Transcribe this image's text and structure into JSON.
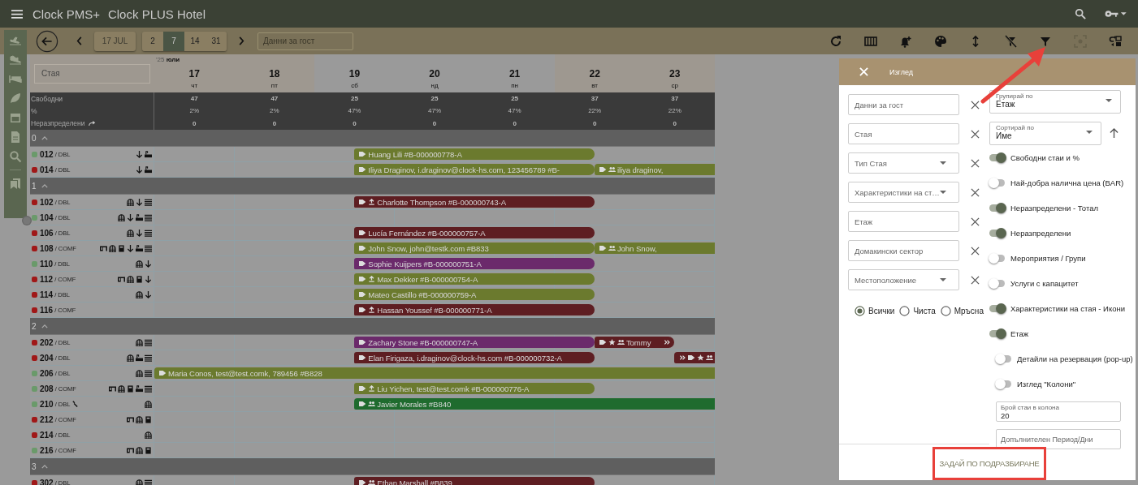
{
  "app": {
    "product": "Clock PMS+",
    "hotel": "Clock PLUS Hotel"
  },
  "toolbar": {
    "date_button": "17 JUL",
    "ranges": [
      {
        "label": "2",
        "selected": false
      },
      {
        "label": "7",
        "selected": true
      },
      {
        "label": "14",
        "selected": false
      },
      {
        "label": "31",
        "selected": false
      }
    ],
    "guest_search": {
      "placeholder": "Данни за гост"
    },
    "tools": [
      {
        "kind": "refresh",
        "disabled": false
      },
      {
        "kind": "columns",
        "disabled": false
      },
      {
        "kind": "bell-plus",
        "disabled": false
      },
      {
        "kind": "palette",
        "disabled": false
      },
      {
        "kind": "updown",
        "disabled": false
      },
      {
        "kind": "filter-off",
        "disabled": false
      },
      {
        "kind": "filter",
        "disabled": false
      },
      {
        "kind": "focus",
        "disabled": true
      },
      {
        "kind": "swap",
        "disabled": false
      }
    ]
  },
  "calendar": {
    "room_search": {
      "placeholder": "Стая"
    },
    "month_label": "'25 **юли**",
    "stat_labels": [
      "Свободни",
      "%",
      "Неразпределени"
    ],
    "days": [
      {
        "date": "17",
        "weekday": "чт",
        "free": "47",
        "percent": "2%",
        "unassigned": "0"
      },
      {
        "date": "18",
        "weekday": "пт",
        "free": "47",
        "percent": "2%",
        "unassigned": "0"
      },
      {
        "date": "19",
        "weekday": "сб",
        "free": "25",
        "percent": "47%",
        "unassigned": "0"
      },
      {
        "date": "20",
        "weekday": "нд",
        "free": "25",
        "percent": "47%",
        "unassigned": "0"
      },
      {
        "date": "21",
        "weekday": "пн",
        "free": "25",
        "percent": "47%",
        "unassigned": "0"
      },
      {
        "date": "22",
        "weekday": "вт",
        "free": "37",
        "percent": "22%",
        "unassigned": "0"
      },
      {
        "date": "23",
        "weekday": "ср",
        "free": "37",
        "percent": "22%",
        "unassigned": "0"
      }
    ],
    "groups": [
      {
        "floor": "0",
        "expanded": true,
        "rooms": [
          {
            "number": "012",
            "type": "/ DBL",
            "color": "#6a9a6a",
            "maintenance": false,
            "features": [
              {
                "kind": "down"
              },
              {
                "kind": "bath"
              }
            ],
            "bookings": [
              {
                "guest": "Huang Lili #B-000000778-A",
                "color": "#6b7a2e",
                "kind": "stay",
                "icons": [
                  {
                    "kind": "tag"
                  }
                ]
              }
            ]
          },
          {
            "number": "014",
            "type": "/ DBL",
            "color": "#a01818",
            "maintenance": false,
            "features": [
              {
                "kind": "down"
              },
              {
                "kind": "bath"
              }
            ],
            "bookings": [
              {
                "guest": "Iliya Draginov, i.draginov@clock-hs.com, 123456789 #B-",
                "color": "#6b7a2e",
                "kind": "stay",
                "icons": [
                  {
                    "kind": "tag"
                  }
                ]
              },
              {
                "guest": "iliya draginov,",
                "color": "#6b7a2e",
                "kind": "late",
                "icons": [
                  {
                    "kind": "tag"
                  },
                  {
                    "kind": "group"
                  }
                ]
              }
            ]
          }
        ]
      },
      {
        "floor": "1",
        "expanded": true,
        "rooms": [
          {
            "number": "102",
            "type": "/ DBL",
            "color": "#a01818",
            "maintenance": false,
            "features": [
              {
                "kind": "dome"
              },
              {
                "kind": "down"
              },
              {
                "kind": "heater"
              }
            ],
            "bookings": [
              {
                "guest": "Charlotte Thompson #B-000000743-A",
                "color": "#5e1e22",
                "kind": "stay",
                "icons": [
                  {
                    "kind": "tag"
                  },
                  {
                    "kind": "checkin"
                  }
                ]
              }
            ]
          },
          {
            "number": "104",
            "type": "/ DBL",
            "color": "#6a9a6a",
            "maintenance": false,
            "features": [
              {
                "kind": "dome"
              },
              {
                "kind": "down"
              },
              {
                "kind": "bath"
              },
              {
                "kind": "heater"
              }
            ]
          },
          {
            "number": "106",
            "type": "/ DBL",
            "color": "#a01818",
            "maintenance": false,
            "features": [
              {
                "kind": "dome"
              },
              {
                "kind": "down"
              },
              {
                "kind": "heater"
              }
            ],
            "bookings": [
              {
                "guest": "Lucía Fernández #B-000000757-A",
                "color": "#5e1e22",
                "kind": "stay",
                "icons": [
                  {
                    "kind": "tag"
                  }
                ]
              }
            ]
          },
          {
            "number": "108",
            "type": "/ COMF",
            "color": "#a01818",
            "maintenance": false,
            "features": [
              {
                "kind": "cabinet"
              },
              {
                "kind": "dome"
              },
              {
                "kind": "fridge"
              },
              {
                "kind": "down"
              },
              {
                "kind": "bath"
              },
              {
                "kind": "heater"
              }
            ],
            "bookings": [
              {
                "guest": "John Snow, john@testk.com #B833",
                "color": "#6b7a2e",
                "kind": "stay",
                "icons": [
                  {
                    "kind": "tag"
                  }
                ]
              },
              {
                "guest": "John Snow,",
                "color": "#6b7a2e",
                "kind": "late",
                "icons": [
                  {
                    "kind": "tag"
                  },
                  {
                    "kind": "group"
                  }
                ]
              }
            ]
          },
          {
            "number": "110",
            "type": "/ DBL",
            "color": "#6a9a6a",
            "maintenance": false,
            "features": [
              {
                "kind": "dome"
              },
              {
                "kind": "down"
              }
            ],
            "bookings": [
              {
                "guest": "Sophie Kuijpers #B-000000751-A",
                "color": "#6b2a6b",
                "kind": "stay",
                "icons": [
                  {
                    "kind": "tag"
                  }
                ]
              }
            ]
          },
          {
            "number": "112",
            "type": "/ COMF",
            "color": "#a01818",
            "maintenance": false,
            "features": [
              {
                "kind": "cabinet"
              },
              {
                "kind": "dome"
              },
              {
                "kind": "fridge"
              },
              {
                "kind": "down"
              }
            ],
            "bookings": [
              {
                "guest": "Max Dekker #B-000000754-A",
                "color": "#6b7a2e",
                "kind": "stay",
                "icons": [
                  {
                    "kind": "tag"
                  },
                  {
                    "kind": "checkin"
                  }
                ]
              }
            ]
          },
          {
            "number": "114",
            "type": "/ DBL",
            "color": "#a01818",
            "maintenance": false,
            "features": [
              {
                "kind": "dome"
              },
              {
                "kind": "down"
              }
            ],
            "bookings": [
              {
                "guest": "Mateo Castillo #B-000000759-A",
                "color": "#6b7a2e",
                "kind": "stay",
                "icons": [
                  {
                    "kind": "tag"
                  }
                ]
              }
            ]
          },
          {
            "number": "116",
            "type": "/ COMF",
            "color": "#a01818",
            "maintenance": false,
            "bookings": [
              {
                "guest": "Hassan Youssef #B-000000771-A",
                "color": "#5e1e22",
                "kind": "stay",
                "icons": [
                  {
                    "kind": "tag"
                  },
                  {
                    "kind": "checkin"
                  }
                ]
              }
            ]
          }
        ]
      },
      {
        "floor": "2",
        "expanded": true,
        "rooms": [
          {
            "number": "202",
            "type": "/ DBL",
            "color": "#a01818",
            "maintenance": false,
            "features": [
              {
                "kind": "dome"
              },
              {
                "kind": "heater"
              }
            ],
            "bookings": [
              {
                "guest": "Zachary Stone #B-000000747-A",
                "color": "#6b2a6b",
                "kind": "stay",
                "icons": [
                  {
                    "kind": "tag"
                  }
                ]
              },
              {
                "guest": "Tommy",
                "color": "#5e1e22",
                "kind": "short",
                "icons": [
                  {
                    "kind": "tag"
                  },
                  {
                    "kind": "star"
                  },
                  {
                    "kind": "group"
                  }
                ],
                "trailing_icons": [
                  {
                    "kind": "chevrons"
                  }
                ]
              }
            ]
          },
          {
            "number": "204",
            "type": "/ DBL",
            "color": "#a01818",
            "maintenance": false,
            "features": [
              {
                "kind": "dome"
              },
              {
                "kind": "bath"
              },
              {
                "kind": "heater"
              }
            ],
            "bookings": [
              {
                "guest": "Elan Firigaza, i.draginov@clock-hs.com #B-000000732-A",
                "color": "#5e1e22",
                "kind": "stay",
                "icons": [
                  {
                    "kind": "tag"
                  }
                ]
              },
              {
                "color": "#5e1e22",
                "kind": "edge",
                "icons": [
                  {
                    "kind": "chevrons"
                  },
                  {
                    "kind": "tag"
                  },
                  {
                    "kind": "star"
                  },
                  {
                    "kind": "group"
                  }
                ]
              }
            ]
          },
          {
            "number": "206",
            "type": "/ DBL",
            "color": "#6a9a6a",
            "maintenance": false,
            "features": [
              {
                "kind": "dome"
              },
              {
                "kind": "heater"
              }
            ],
            "bookings": [
              {
                "guest": "Maria Conos, test@test.comk, 789456 #B828",
                "color": "#6b7a2e",
                "kind": "full",
                "icons": [
                  {
                    "kind": "tag"
                  }
                ]
              }
            ]
          },
          {
            "number": "208",
            "type": "/ COMF",
            "color": "#6a9a6a",
            "maintenance": false,
            "features": [
              {
                "kind": "cabinet"
              },
              {
                "kind": "dome"
              },
              {
                "kind": "fridge"
              },
              {
                "kind": "bath"
              },
              {
                "kind": "heater"
              }
            ],
            "bookings": [
              {
                "guest": "Liu Yichen, test@test.comk #B-000000776-A",
                "color": "#6b7a2e",
                "kind": "stay",
                "icons": [
                  {
                    "kind": "tag"
                  },
                  {
                    "kind": "checkin"
                  }
                ]
              }
            ]
          },
          {
            "number": "210",
            "type": "/ DBL",
            "color": "#6a9a6a",
            "maintenance": true,
            "features": [
              {
                "kind": "dome"
              }
            ],
            "bookings": [
              {
                "guest": "Javier Morales #B840",
                "color": "#1f6b2e",
                "kind": "open",
                "icons": [
                  {
                    "kind": "tag"
                  },
                  {
                    "kind": "group"
                  }
                ]
              }
            ]
          },
          {
            "number": "212",
            "type": "/ COMF",
            "color": "#a01818",
            "maintenance": false,
            "features": [
              {
                "kind": "cabinet"
              },
              {
                "kind": "dome"
              },
              {
                "kind": "fridge"
              }
            ]
          },
          {
            "number": "214",
            "type": "/ DBL",
            "color": "#a01818",
            "maintenance": false,
            "features": [
              {
                "kind": "dome"
              }
            ]
          },
          {
            "number": "216",
            "type": "/ COMF",
            "color": "#6a9a6a",
            "maintenance": false,
            "features": [
              {
                "kind": "cabinet"
              },
              {
                "kind": "dome"
              },
              {
                "kind": "fridge"
              }
            ]
          }
        ]
      },
      {
        "floor": "3",
        "expanded": true,
        "rooms": [
          {
            "number": "302",
            "type": "/ DBL",
            "color": "#a01818",
            "maintenance": false,
            "features": [
              {
                "kind": "dome"
              },
              {
                "kind": "heater"
              }
            ],
            "bookings": [
              {
                "guest": "Ethan Marshall #B839",
                "color": "#5e1e22",
                "kind": "stay",
                "icons": [
                  {
                    "kind": "tag"
                  },
                  {
                    "kind": "group"
                  }
                ]
              }
            ]
          }
        ]
      }
    ]
  },
  "view_panel": {
    "title": "Изглед",
    "filters": [
      {
        "placeholder": "Данни за гост",
        "kind": "text"
      },
      {
        "placeholder": "Стая",
        "kind": "text"
      },
      {
        "placeholder": "Тип Стая",
        "kind": "select"
      },
      {
        "placeholder": "Характеристики на ст…",
        "kind": "select"
      },
      {
        "placeholder": "Етаж",
        "kind": "text"
      },
      {
        "placeholder": "Домакински сектор",
        "kind": "text"
      },
      {
        "placeholder": "Местоположение",
        "kind": "select"
      }
    ],
    "cleanliness": [
      {
        "label": "Всички",
        "selected": true
      },
      {
        "label": "Чиста",
        "selected": false
      },
      {
        "label": "Мръсна",
        "selected": false
      }
    ],
    "group_by": {
      "label": "Групирай по",
      "value": "Етаж"
    },
    "sort_by": {
      "label": "Сортирай по",
      "value": "Име"
    },
    "toggles": [
      {
        "label": "Свободни стаи и %",
        "on": true
      },
      {
        "label": "Най-добра налична цена (BAR)",
        "on": false
      },
      {
        "label": "Неразпределени - Тотал",
        "on": true
      },
      {
        "label": "Неразпределени",
        "on": true
      },
      {
        "label": "Мероприятия / Групи",
        "on": false
      },
      {
        "label": "Услуги с капацитет",
        "on": false
      },
      {
        "label": "Характеристики на стая - Икони",
        "on": true
      },
      {
        "label": "Етаж",
        "on": true,
        "children": [
          {
            "label": "Детайли на резервация (pop-up)",
            "on": false
          },
          {
            "label": "Изглед \"Колони\"",
            "on": false
          }
        ]
      }
    ],
    "rooms_per_column": {
      "label": "Брой стаи в колона",
      "value": "20"
    },
    "extra_period": {
      "placeholder": "Допълнителен Период/Дни"
    },
    "default_button": "ЗАДАЙ ПО ПОДРАЗБИРАНЕ"
  }
}
